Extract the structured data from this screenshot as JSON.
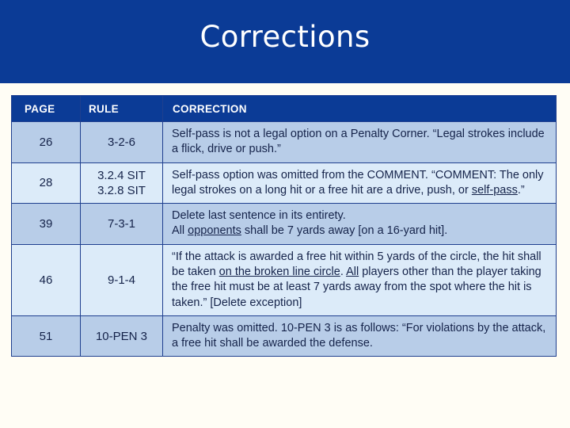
{
  "slide": {
    "title": "Corrections",
    "banner_color": "#0b3b96",
    "background_color": "#fffdf5"
  },
  "table": {
    "headers": {
      "page": "PAGE",
      "rule": "RULE",
      "correction": "CORRECTION"
    },
    "row_colors": {
      "shade_a": "#b8cde8",
      "shade_b": "#dcebf9",
      "header": "#0b3b96",
      "border": "#1f3f8f",
      "text": "#15234a"
    },
    "rows": [
      {
        "page": "26",
        "rule": "3-2-6",
        "correction_lines": [
          "Self-pass is not a legal option on a Penalty Corner.  “Legal",
          "strokes include a flick, drive or push.”"
        ]
      },
      {
        "page": "28",
        "rule_lines": [
          "3.2.4 SIT",
          "3.2.8 SIT"
        ],
        "correction_lines": [
          "Self-pass option was omitted from the COMMENT.",
          "“COMMENT: The only legal strokes on a long hit or a free hit",
          "are a drive, push, or "
        ],
        "underlined_tail": "self-pass",
        "tail_after": ".”"
      },
      {
        "page": "39",
        "rule": "7-3-1",
        "correction_lines": [
          "Delete last sentence in its entirety.",
          "All "
        ],
        "underlined_mid": "opponents",
        "line2_tail": " shall be 7 yards away [on a 16-yard hit]."
      },
      {
        "page": "46",
        "rule": "9-1-4",
        "correction_segments": [
          "“If the attack is awarded a free hit within 5 yards of the circle, the hit shall be taken ",
          "on the broken line circle",
          ".  ",
          "All",
          " players other than the player taking the free hit must be at least 7 yards away from the spot where the hit is taken.”  [Delete exception]"
        ]
      },
      {
        "page": "51",
        "rule": "10-PEN 3",
        "correction_lines": [
          "Penalty was omitted.  10-PEN 3 is as follows: “For violations by",
          "the attack, a free hit shall be awarded the defense."
        ]
      }
    ]
  }
}
